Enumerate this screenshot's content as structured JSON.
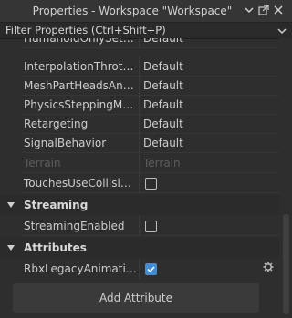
{
  "window": {
    "title": "Properties - Workspace \"Workspace\""
  },
  "filter": {
    "placeholder": "Filter Properties (Ctrl+Shift+P)"
  },
  "properties": [
    {
      "name": "HumanoidOnlySetCo...",
      "value": "Default"
    },
    {
      "name": "InterpolationThrottling",
      "value": "Default"
    },
    {
      "name": "MeshPartHeadsAndAc...",
      "value": "Default"
    },
    {
      "name": "PhysicsSteppingMeth...",
      "value": "Default"
    },
    {
      "name": "Retargeting",
      "value": "Default"
    },
    {
      "name": "SignalBehavior",
      "value": "Default"
    },
    {
      "name": "Terrain",
      "value": "Terrain"
    },
    {
      "name": "TouchesUseCollision...",
      "value": ""
    }
  ],
  "streaming": {
    "header": "Streaming",
    "property": {
      "name": "StreamingEnabled"
    }
  },
  "attributes": {
    "header": "Attributes",
    "property": {
      "name": "RbxLegacyAnimation..."
    },
    "add_label": "Add Attribute"
  },
  "colors": {
    "checked": "#3b8ee6",
    "background": "#2e2e2e"
  }
}
